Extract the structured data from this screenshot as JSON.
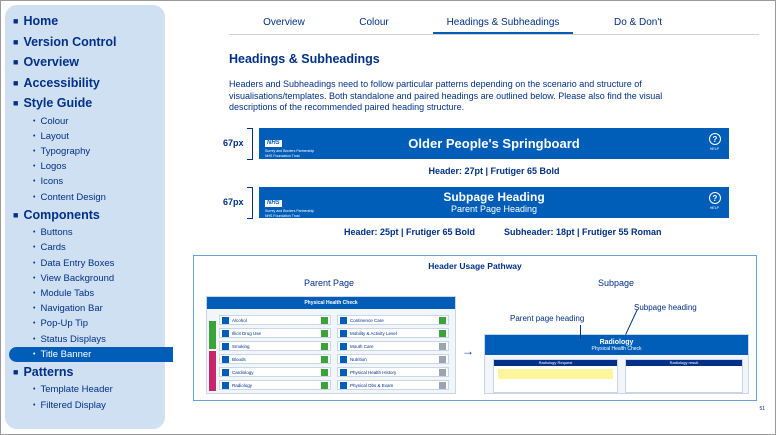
{
  "sidebar": {
    "sections": [
      {
        "label": "Home"
      },
      {
        "label": "Version Control"
      },
      {
        "label": "Overview"
      },
      {
        "label": "Accessibility"
      },
      {
        "label": "Style Guide",
        "items": [
          "Colour",
          "Layout",
          "Typography",
          "Logos",
          "Icons",
          "Content Design"
        ]
      },
      {
        "label": "Components",
        "items": [
          "Buttons",
          "Cards",
          "Data Entry Boxes",
          "View Background",
          "Module Tabs",
          "Navigation Bar",
          "Pop-Up Tip",
          "Status Displays",
          "Title Banner"
        ]
      },
      {
        "label": "Patterns",
        "items": [
          "Template Header",
          "Filtered Display"
        ]
      }
    ],
    "active_item": "Title Banner"
  },
  "tabs": [
    {
      "label": "Overview"
    },
    {
      "label": "Colour"
    },
    {
      "label": "Headings & Subheadings",
      "active": true
    },
    {
      "label": "Do & Don't"
    }
  ],
  "main": {
    "title": "Headings & Subheadings",
    "description": "Headers and Subheadings need to follow particular patterns depending on the scenario and structure of visualisations/templates. Both standalone and paired headings are outlined below. Please also find the visual descriptions of the recommended paired heading structure.",
    "height_label": "67px",
    "nhs_logo": "NHS",
    "org_name": "Surrey and Borders Partnership",
    "org_sub": "NHS Foundation Trust",
    "help_glyph": "?",
    "help_text": "HELP",
    "banner1": {
      "title": "Older People's Springboard",
      "caption": "Header: 27pt | Frutiger 65 Bold"
    },
    "banner2": {
      "title": "Subpage Heading",
      "subtitle": "Parent Page Heading",
      "caption_left": "Header: 25pt | Frutiger 65 Bold",
      "caption_right": "Subheader: 18pt | Frutiger 55 Roman"
    }
  },
  "pathway": {
    "title": "Header Usage Pathway",
    "parent_label": "Parent Page",
    "subpage_label": "Subpage",
    "parent_page_heading_label": "Parent page heading",
    "subpage_heading_label": "Subpage heading",
    "parent_mock": {
      "header": "Physical Health Check",
      "left_items": [
        "Alcohol",
        "Illicit Drug Use",
        "Smoking",
        "Bloods",
        "Cardiology",
        "Radiology"
      ],
      "right_items": [
        "Continence Care",
        "Mobility & Activity Level",
        "Mouth Care",
        "Nutrition",
        "Physical Health History",
        "Physical Obs & Exam"
      ]
    },
    "sub_mock": {
      "header": "Radiology",
      "subheader": "Physical Health Check",
      "col1": "Radiology Request",
      "col2": "Radiology result"
    },
    "arrow_glyph": "→"
  },
  "page_number": "51",
  "colors": {
    "nhs_blue": "#005eb8",
    "dark_blue": "#003087",
    "sidebar_bg": "#cfe0f2"
  }
}
